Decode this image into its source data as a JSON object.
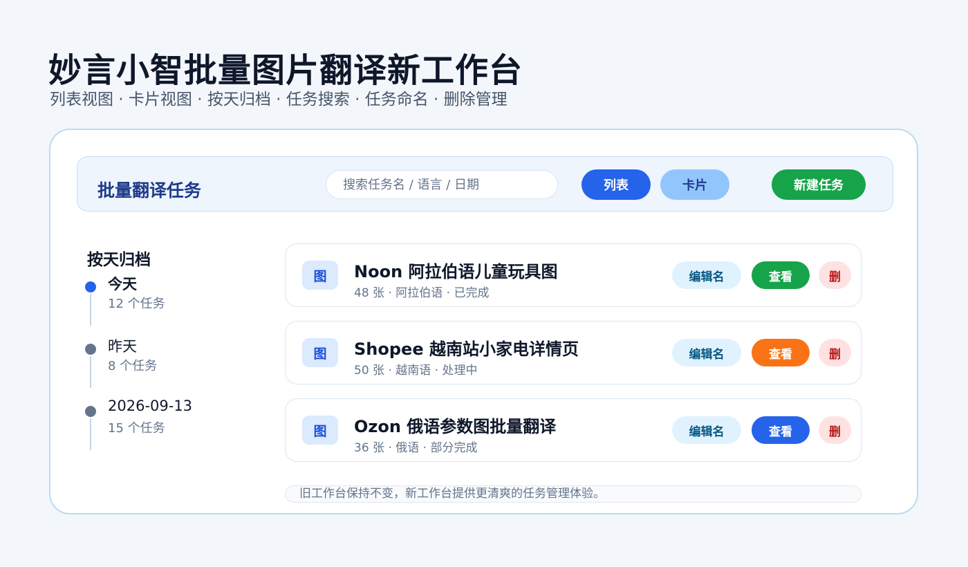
{
  "hero": {
    "title": "妙言小智批量图片翻译新工作台",
    "subtitle": "列表视图 · 卡片视图 · 按天归档 · 任务搜索 · 任务命名 · 删除管理"
  },
  "toolbar": {
    "title": "批量翻译任务",
    "search_placeholder": "搜索任务名 / 语言 / 日期",
    "list_label": "列表",
    "card_label": "卡片",
    "new_label": "新建任务"
  },
  "archive": {
    "title": "按天归档",
    "days": [
      {
        "name": "今天",
        "count": "12 个任务",
        "active": true
      },
      {
        "name": "昨天",
        "count": "8 个任务",
        "active": false
      },
      {
        "name": "2026-09-13",
        "count": "15 个任务",
        "active": false
      }
    ]
  },
  "tasks": [
    {
      "thumb": "图",
      "name": "Noon 阿拉伯语儿童玩具图",
      "meta": "48 张 · 阿拉伯语 · 已完成",
      "rename": "编辑名",
      "view": "查看",
      "view_color": "#16a34a",
      "delete": "删"
    },
    {
      "thumb": "图",
      "name": "Shopee 越南站小家电详情页",
      "meta": "50 张 · 越南语 · 处理中",
      "rename": "编辑名",
      "view": "查看",
      "view_color": "#f97316",
      "delete": "删"
    },
    {
      "thumb": "图",
      "name": "Ozon 俄语参数图批量翻译",
      "meta": "36 张 · 俄语 · 部分完成",
      "rename": "编辑名",
      "view": "查看",
      "view_color": "#2563eb",
      "delete": "删"
    }
  ],
  "footer": {
    "note": "旧工作台保持不变，新工作台提供更清爽的任务管理体验。"
  }
}
